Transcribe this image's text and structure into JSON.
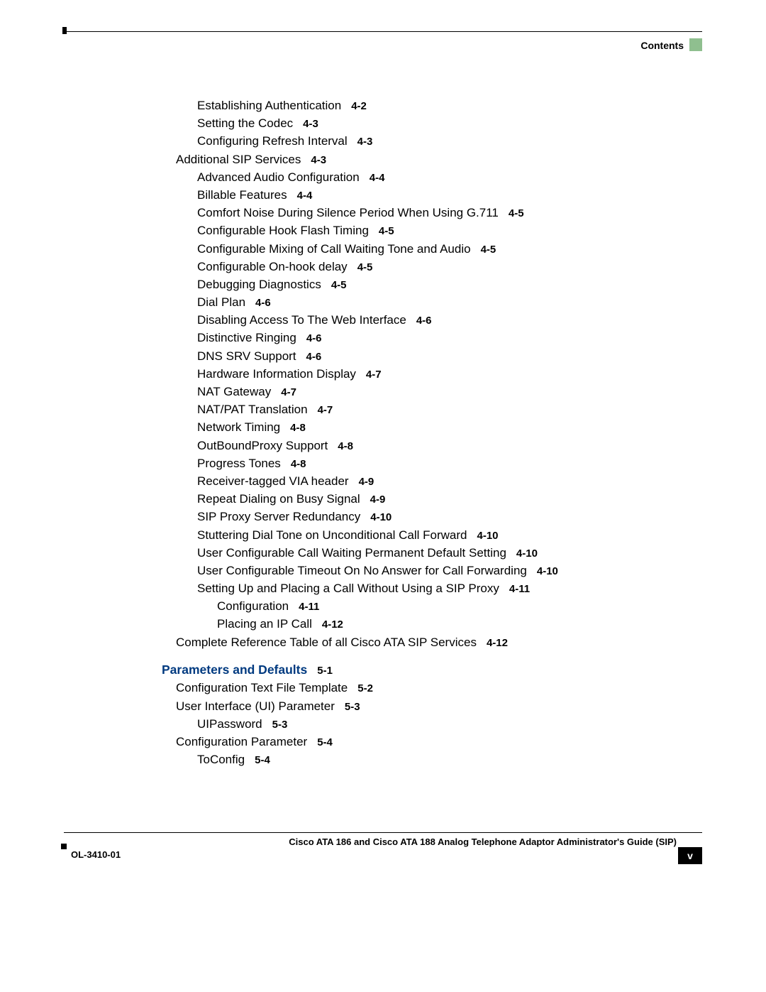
{
  "header": {
    "section_label": "Contents"
  },
  "toc": {
    "sec4": [
      {
        "indent": 1,
        "title": "Establishing Authentication",
        "pref": "4-2"
      },
      {
        "indent": 1,
        "title": "Setting the Codec",
        "pref": "4-3"
      },
      {
        "indent": 1,
        "title": "Configuring Refresh Interval",
        "pref": "4-3"
      },
      {
        "indent": 0,
        "title": "Additional SIP Services",
        "pref": "4-3"
      },
      {
        "indent": 1,
        "title": "Advanced Audio Configuration",
        "pref": "4-4"
      },
      {
        "indent": 1,
        "title": "Billable Features",
        "pref": "4-4"
      },
      {
        "indent": 1,
        "title": "Comfort Noise During Silence Period When Using G.711",
        "pref": "4-5"
      },
      {
        "indent": 1,
        "title": "Configurable Hook Flash Timing",
        "pref": "4-5"
      },
      {
        "indent": 1,
        "title": "Configurable Mixing of Call Waiting Tone and Audio",
        "pref": "4-5"
      },
      {
        "indent": 1,
        "title": "Configurable On-hook delay",
        "pref": "4-5"
      },
      {
        "indent": 1,
        "title": "Debugging Diagnostics",
        "pref": "4-5"
      },
      {
        "indent": 1,
        "title": "Dial Plan",
        "pref": "4-6"
      },
      {
        "indent": 1,
        "title": "Disabling Access To The Web Interface",
        "pref": "4-6"
      },
      {
        "indent": 1,
        "title": "Distinctive Ringing",
        "pref": "4-6"
      },
      {
        "indent": 1,
        "title": "DNS SRV Support",
        "pref": "4-6"
      },
      {
        "indent": 1,
        "title": "Hardware Information Display",
        "pref": "4-7"
      },
      {
        "indent": 1,
        "title": "NAT Gateway",
        "pref": "4-7"
      },
      {
        "indent": 1,
        "title": "NAT/PAT Translation",
        "pref": "4-7"
      },
      {
        "indent": 1,
        "title": "Network Timing",
        "pref": "4-8"
      },
      {
        "indent": 1,
        "title": "OutBoundProxy Support",
        "pref": "4-8"
      },
      {
        "indent": 1,
        "title": "Progress Tones",
        "pref": "4-8"
      },
      {
        "indent": 1,
        "title": "Receiver-tagged VIA header",
        "pref": "4-9"
      },
      {
        "indent": 1,
        "title": "Repeat Dialing on Busy Signal",
        "pref": "4-9"
      },
      {
        "indent": 1,
        "title": "SIP Proxy Server Redundancy",
        "pref": "4-10"
      },
      {
        "indent": 1,
        "title": "Stuttering Dial Tone on Unconditional Call Forward",
        "pref": "4-10"
      },
      {
        "indent": 1,
        "title": "User Configurable Call Waiting Permanent Default Setting",
        "pref": "4-10"
      },
      {
        "indent": 1,
        "title": "User Configurable Timeout On No Answer for Call Forwarding",
        "pref": "4-10"
      },
      {
        "indent": 1,
        "title": "Setting Up and Placing a Call Without Using a SIP Proxy",
        "pref": "4-11"
      },
      {
        "indent": 2,
        "title": "Configuration",
        "pref": "4-11"
      },
      {
        "indent": 2,
        "title": "Placing an IP Call",
        "pref": "4-12"
      },
      {
        "indent": 0,
        "title": "Complete Reference Table of all Cisco ATA SIP Services",
        "pref": "4-12"
      }
    ],
    "chapter5": {
      "title": "Parameters and Defaults",
      "pref": "5-1"
    },
    "sec5": [
      {
        "indent": 0,
        "title": "Configuration Text File Template",
        "pref": "5-2"
      },
      {
        "indent": 0,
        "title": "User Interface (UI) Parameter",
        "pref": "5-3"
      },
      {
        "indent": 1,
        "title": "UIPassword",
        "pref": "5-3"
      },
      {
        "indent": 0,
        "title": "Configuration Parameter",
        "pref": "5-4"
      },
      {
        "indent": 1,
        "title": "ToConfig",
        "pref": "5-4"
      }
    ]
  },
  "footer": {
    "guide_title": "Cisco ATA 186 and Cisco ATA 188 Analog Telephone Adaptor Administrator's Guide (SIP)",
    "doc_id": "OL-3410-01",
    "page_num": "v"
  }
}
